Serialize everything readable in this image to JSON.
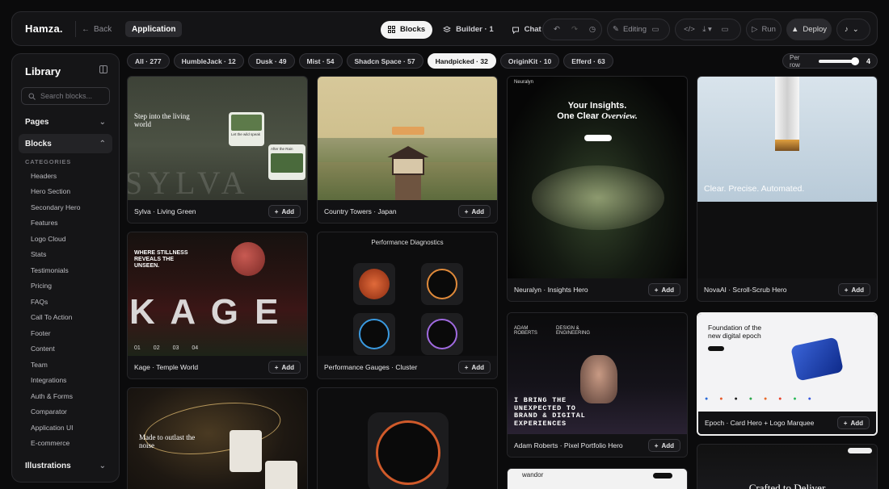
{
  "topbar": {
    "brand": "Hamza.",
    "back_label": "Back",
    "app_label": "Application",
    "tabs": [
      {
        "label": "Blocks",
        "icon": "grid-icon",
        "active": true
      },
      {
        "label": "Builder · 1",
        "icon": "layers-icon",
        "active": false
      },
      {
        "label": "Chat",
        "icon": "chat-bubble-icon",
        "active": false
      }
    ],
    "editing_label": "Editing",
    "run_label": "Run",
    "deploy_label": "Deploy"
  },
  "sidebar": {
    "title": "Library",
    "search_placeholder": "Search blocks...",
    "pages_label": "Pages",
    "blocks_label": "Blocks",
    "categories_label": "CATEGORIES",
    "categories": [
      "Headers",
      "Hero Section",
      "Secondary Hero",
      "Features",
      "Logo Cloud",
      "Stats",
      "Testimonials",
      "Pricing",
      "FAQs",
      "Call To Action",
      "Footer",
      "Content",
      "Team",
      "Integrations",
      "Auth & Forms",
      "Comparator",
      "Application UI",
      "E-commerce"
    ],
    "illustrations_label": "Illustrations"
  },
  "filters": {
    "chips": [
      {
        "label": "All · 277",
        "active": false
      },
      {
        "label": "HumbleJack · 12",
        "active": false
      },
      {
        "label": "Dusk · 49",
        "active": false
      },
      {
        "label": "Mist · 54",
        "active": false
      },
      {
        "label": "Shadcn Space · 57",
        "active": false
      },
      {
        "label": "Handpicked · 32",
        "active": true
      },
      {
        "label": "OriginKit · 10",
        "active": false
      },
      {
        "label": "Efferd · 63",
        "active": false
      }
    ],
    "per_row_label": "Per row",
    "per_row_value": "4",
    "per_row_level": 1.0
  },
  "add_label": "Add",
  "cards": {
    "sylva": {
      "title": "Sylva · Living Green",
      "hero_text": "Step into the living world",
      "big_word": "SYLVA",
      "mini1": "Let the wild speak",
      "mini2": "After the Rain"
    },
    "country": {
      "title": "Country Towers · Japan"
    },
    "neuralyn": {
      "title": "Neuralyn · Insights Hero",
      "brand": "Neuralyn",
      "heading1": "Your Insights.",
      "heading2": "One Clear",
      "heading2_em": "Overview."
    },
    "nova": {
      "title": "NovaAI · Scroll-Scrub Hero",
      "overlay": "Clear. Precise. Automated."
    },
    "kage": {
      "title": "Kage · Temple World",
      "heading": "WHERE STILLNESS REVEALS THE UNSEEN.",
      "big_word": "K A G E",
      "nums": [
        "01",
        "02",
        "03",
        "04"
      ]
    },
    "perf": {
      "title": "Performance Gauges · Cluster",
      "heading": "Performance Diagnostics"
    },
    "adam": {
      "title": "Adam Roberts · Pixel Portfolio Hero",
      "name": "ADAM ROBERTS",
      "tag": "DESIGN & ENGINEERING",
      "heading": "I BRING THE UNEXPECTED TO BRAND & DIGITAL EXPERIENCES"
    },
    "epoch": {
      "title": "Epoch · Card Hero + Logo Marquee",
      "heading": "Foundation of the new digital epoch"
    },
    "outlast": {
      "heading": "Made to outlast the noise"
    },
    "wandor": {
      "brand": "wandor"
    },
    "dark": {
      "heading": "Crafted to Deliver"
    }
  },
  "colors": {
    "bg": "#0b0b0c",
    "panel": "#141416",
    "accent_active": "#f4f4f4"
  }
}
